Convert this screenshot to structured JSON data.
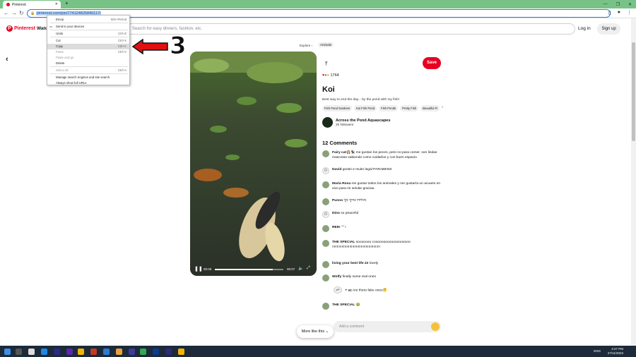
{
  "browser": {
    "tab_title": "Pinterest",
    "url": "pinterest.com/pin/774124825840117/",
    "new_tab": "+",
    "window_controls": [
      "—",
      "❐",
      "✕"
    ]
  },
  "menu": {
    "items": [
      {
        "label": "Emoji",
        "shortcut": "Win+Period",
        "disabled": false
      },
      {
        "label": "Send to your devices",
        "shortcut": "",
        "disabled": false
      },
      {
        "label": "Undo",
        "shortcut": "Ctrl+Z",
        "disabled": false
      },
      {
        "label": "Cut",
        "shortcut": "Ctrl+X",
        "disabled": false
      },
      {
        "label": "Copy",
        "shortcut": "Ctrl+C",
        "disabled": false
      },
      {
        "label": "Paste",
        "shortcut": "Ctrl+V",
        "disabled": true
      },
      {
        "label": "Paste and go",
        "shortcut": "",
        "disabled": true
      },
      {
        "label": "Delete",
        "shortcut": "",
        "disabled": false
      },
      {
        "label": "Select all",
        "shortcut": "Ctrl+A",
        "disabled": true
      },
      {
        "label": "Manage search engines and site search",
        "shortcut": "",
        "disabled": false
      },
      {
        "label": "Always show full URLs",
        "shortcut": "",
        "disabled": false
      }
    ],
    "highlighted": "Copy"
  },
  "annotation": {
    "step": "3"
  },
  "header": {
    "logo": "P",
    "brand": "Pinterest",
    "watch": "Watch",
    "search_placeholder": "Search for easy dinners, fashion, etc.",
    "login": "Log in",
    "signup": "Sign up"
  },
  "breadcrumb": {
    "explore": "Explore",
    "sep": "›",
    "current": "Animals"
  },
  "video": {
    "time_current": "00:06",
    "time_total": "00:07",
    "progress": 0.85
  },
  "pin": {
    "save_label": "Save",
    "reaction_count": "1764",
    "title": "Koi",
    "description": "Best way to end the day... by the pond with my fish!",
    "tags": [
      "Fish Pond Gardens",
      "Koi Fish Pond",
      "Fish Ponds",
      "Pretty Fish",
      "Beautiful Fi"
    ],
    "creator": "Across the Pond Aquascapes",
    "followers": "2k followers"
  },
  "comments": {
    "count_label": "12 Comments",
    "items": [
      {
        "user": "Fairy cat👸🏻🐈‍⬛",
        "text": "me gustan los peces, pero no para comer. son lindas mascotas sabiendo como cuidarlos y con buen espacio",
        "initial": ""
      },
      {
        "user": "David",
        "text": "gostei e muito legal PARABENS",
        "initial": "D"
      },
      {
        "user": "Maria Rosa",
        "text": "me gustar todos los animales y me gustaría un acuario en vivo para mi selular gracias.",
        "initial": ""
      },
      {
        "user": "Punno",
        "text": "খুব সুন্দর লাগছে",
        "initial": ""
      },
      {
        "user": "Dino",
        "text": "so peaceful",
        "initial": "D"
      },
      {
        "user": "REIK",
        "text": "ᐢᐢ !",
        "initial": ""
      },
      {
        "user": "THE SPECIAL",
        "text": "sooooooo cooooooooooooooooooo !!!!!!!!!!!!!!!!!!!!!!!!!!!!!!!!!!!!!!!!!!!!!!!!!!",
        "initial": ""
      },
      {
        "user": "living your best life 22",
        "text": "lovely",
        "initial": ""
      },
      {
        "user": "Wolfy",
        "text": "finally some real ones",
        "initial": ""
      },
      {
        "user": "THE SPECIAL",
        "text": "😂",
        "initial": ""
      }
    ],
    "reply": {
      "initial": "c!P",
      "user": "+ az",
      "text": "Are there fake ones🤔"
    }
  },
  "add_comment_placeholder": "Add a comment",
  "more_like_this": "More like this",
  "taskbar": {
    "lang": "ENG",
    "time": "4:27 PM",
    "date": "27/11/2023"
  }
}
